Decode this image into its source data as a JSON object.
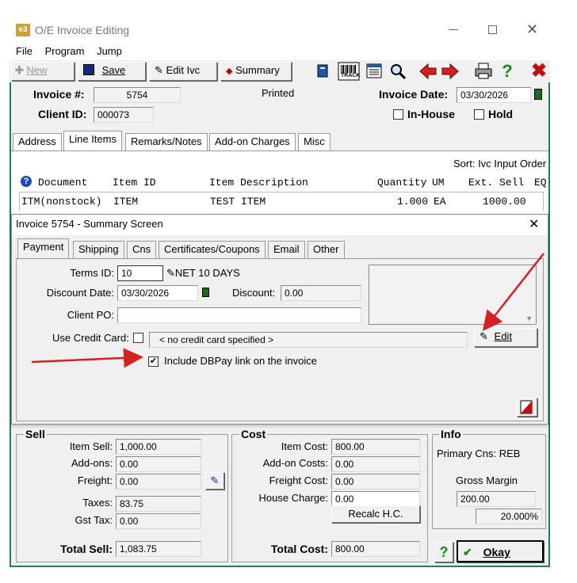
{
  "window": {
    "title": "O/E Invoice Editing",
    "app_icon": "e3",
    "minimize_icon": "minimize-icon",
    "maximize_icon": "maximize-icon",
    "close_icon": "close-icon"
  },
  "menu": [
    "File",
    "Program",
    "Jump"
  ],
  "toolbar": {
    "new_label": "New",
    "save_label": "Save",
    "edit_label": "Edit Ivc",
    "summary_label": "Summary",
    "track_label": "TRACK"
  },
  "header": {
    "invoice_label": "Invoice #:",
    "invoice_value": "5754",
    "status": "Printed",
    "client_label": "Client ID:",
    "client_value": "000073",
    "date_label": "Invoice Date:",
    "date_value": "03/30/2026",
    "inhouse_label": "In-House",
    "hold_label": "Hold"
  },
  "main_tabs": [
    "Address",
    "Line Items",
    "Remarks/Notes",
    "Add-on Charges",
    "Misc"
  ],
  "line_items": {
    "sort_label": "Sort: Ivc Input Order",
    "columns": [
      "Document",
      "Item ID",
      "Item Description",
      "Quantity",
      "UM",
      "Ext. Sell",
      "EQ"
    ],
    "rows": [
      {
        "document": "ITM(nonstock)",
        "item_id": "ITEM",
        "description": "TEST ITEM",
        "quantity": "1.000",
        "um": "EA",
        "ext_sell": "1000.00"
      }
    ]
  },
  "summary": {
    "title": "Invoice 5754 - Summary Screen",
    "tabs": [
      "Payment",
      "Shipping",
      "Cns",
      "Certificates/Coupons",
      "Email",
      "Other"
    ],
    "terms_label": "Terms ID:",
    "terms_value": "10",
    "terms_desc": "NET 10 DAYS",
    "discount_date_label": "Discount Date:",
    "discount_date_value": "03/30/2026",
    "discount_label": "Discount:",
    "discount_value": "0.00",
    "client_po_label": "Client PO:",
    "client_po_value": "",
    "credit_label": "Use Credit Card:",
    "credit_value": "< no credit card specified >",
    "edit_button": "Edit",
    "dbpay_label": "Include DBPay link on the invoice"
  },
  "sell": {
    "title": "Sell",
    "item_sell_label": "Item Sell:",
    "item_sell": "1,000.00",
    "addons_label": "Add-ons:",
    "addons": "0.00",
    "freight_label": "Freight:",
    "freight": "0.00",
    "taxes_label": "Taxes:",
    "taxes": "83.75",
    "gst_label": "Gst Tax:",
    "gst": "0.00",
    "total_label": "Total Sell:",
    "total": "1,083.75"
  },
  "cost": {
    "title": "Cost",
    "item_cost_label": "Item Cost:",
    "item_cost": "800.00",
    "addon_costs_label": "Add-on Costs:",
    "addon_costs": "0.00",
    "freight_cost_label": "Freight Cost:",
    "freight_cost": "0.00",
    "house_label": "House Charge:",
    "house": "0.00",
    "recalc_button": "Recalc H.C.",
    "total_label": "Total Cost:",
    "total": "800.00"
  },
  "info": {
    "title": "Info",
    "primary_cns": "Primary Cns: REB",
    "gross_margin_label": "Gross Margin",
    "gross_margin_value": "200.00",
    "gross_margin_pct": "20.000%"
  },
  "footer": {
    "help_label": "?",
    "okay_label": "Okay"
  },
  "colors": {
    "accent_arrow": "#d42020",
    "teal_border": "#1f7a6e",
    "window_bg": "#f0f0f0"
  }
}
